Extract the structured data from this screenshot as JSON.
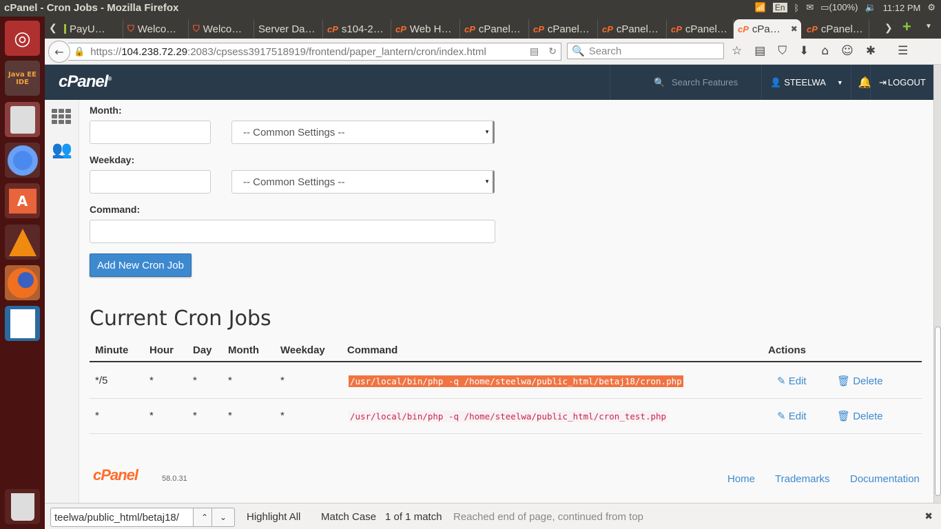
{
  "os": {
    "window_title": "cPanel - Cron Jobs - Mozilla Firefox",
    "tray": {
      "keyboard": "En",
      "battery": "(100%)",
      "clock": "11:12 PM"
    },
    "launcher": [
      {
        "name": "ubuntu-dash",
        "label": ""
      },
      {
        "name": "java-ee-ide",
        "label": "Java EE IDE"
      },
      {
        "name": "files",
        "label": ""
      },
      {
        "name": "chromium",
        "label": ""
      },
      {
        "name": "software-center",
        "label": "A"
      },
      {
        "name": "vlc",
        "label": ""
      },
      {
        "name": "firefox",
        "label": ""
      },
      {
        "name": "libreoffice-impress",
        "label": ""
      },
      {
        "name": "trash",
        "label": ""
      }
    ]
  },
  "browser": {
    "tabs": [
      {
        "label": "PayU…",
        "icon": "payu"
      },
      {
        "label": "Welco…",
        "icon": "magento"
      },
      {
        "label": "Welco…",
        "icon": "magento"
      },
      {
        "label": "Server Da…",
        "icon": "none"
      },
      {
        "label": "s104-2…",
        "icon": "cpanel"
      },
      {
        "label": "Web H…",
        "icon": "cpanel"
      },
      {
        "label": "cPanel…",
        "icon": "cpanel"
      },
      {
        "label": "cPanel…",
        "icon": "cpanel"
      },
      {
        "label": "cPanel…",
        "icon": "cpanel"
      },
      {
        "label": "cPanel…",
        "icon": "cpanel"
      },
      {
        "label": "cPa…",
        "icon": "cpanel",
        "active": true
      },
      {
        "label": "cPanel…",
        "icon": "cpanel"
      }
    ],
    "url": {
      "scheme": "https://",
      "host": "104.238.72.29",
      "rest": ":2083/cpsess3917518919/frontend/paper_lantern/cron/index.html"
    },
    "search_placeholder": "Search"
  },
  "cpanel": {
    "logo": "cPanel",
    "search_placeholder": "Search Features",
    "user": "STEELWA",
    "logout": "LOGOUT",
    "form": {
      "month_label": "Month:",
      "weekday_label": "Weekday:",
      "command_label": "Command:",
      "common_settings": "-- Common Settings --",
      "month_value": "",
      "weekday_value": "",
      "command_value": "",
      "add_button": "Add New Cron Job"
    },
    "jobs": {
      "title": "Current Cron Jobs",
      "columns": [
        "Minute",
        "Hour",
        "Day",
        "Month",
        "Weekday",
        "Command",
        "Actions"
      ],
      "rows": [
        {
          "minute": "*/5",
          "hour": "*",
          "day": "*",
          "month": "*",
          "weekday": "*",
          "command": "/usr/local/bin/php -q /home/steelwa/public_html/betaj18/cron.php",
          "highlighted": true
        },
        {
          "minute": "*",
          "hour": "*",
          "day": "*",
          "month": "*",
          "weekday": "*",
          "command": "/usr/local/bin/php -q /home/steelwa/public_html/cron_test.php",
          "highlighted": false
        }
      ],
      "edit_label": "Edit",
      "delete_label": "Delete"
    },
    "footer": {
      "logo": "cPanel",
      "version": "58.0.31",
      "links": [
        "Home",
        "Trademarks",
        "Documentation"
      ]
    },
    "colors": {
      "header": "#293a4a",
      "accent": "#3c89d0",
      "brand_orange": "#ff6c2c",
      "find_highlight": "#ef7442"
    }
  },
  "findbar": {
    "query": "teelwa/public_html/betaj18/",
    "highlight_all": "Highlight All",
    "match_case": "Match Case",
    "match_count": "1 of 1 match",
    "status": "Reached end of page, continued from top"
  }
}
